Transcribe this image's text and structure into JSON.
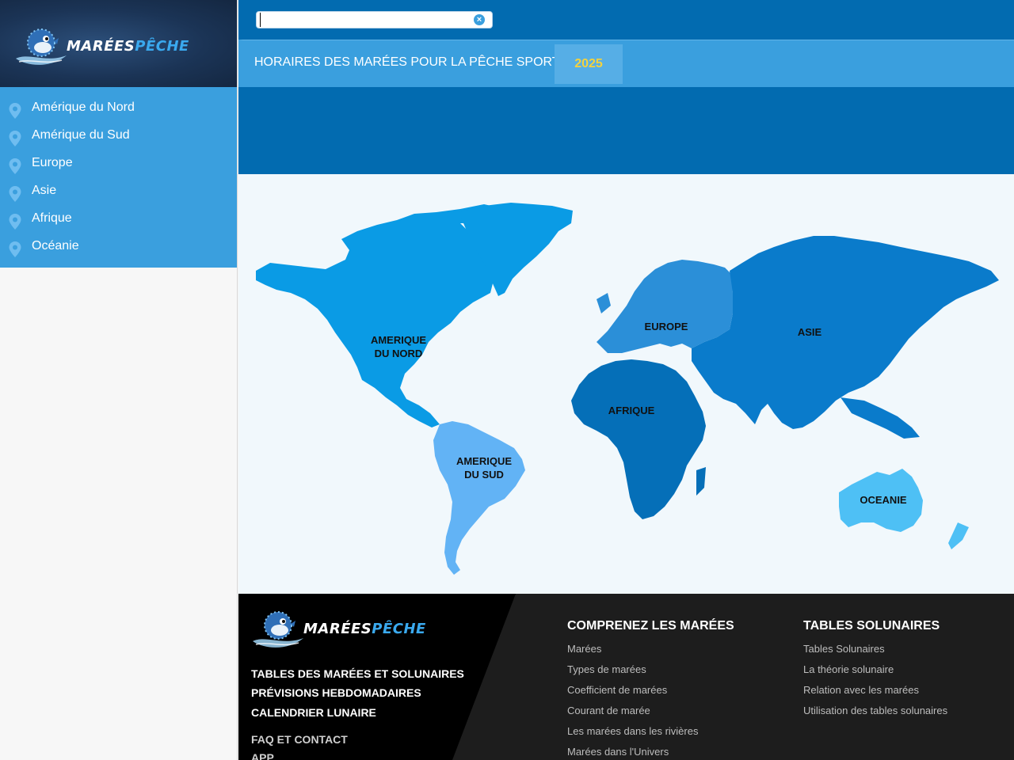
{
  "brand": {
    "logo_white": "MARÉES",
    "logo_blue": "PÊCHE"
  },
  "search": {
    "value": "",
    "placeholder": "",
    "clear_icon": "clear-circle-icon"
  },
  "header": {
    "title": "HORAIRES DES MARÉES POUR LA PÊCHE SPORTIVE",
    "year": "2025"
  },
  "sidebar": {
    "items": [
      {
        "label": "Amérique du Nord",
        "icon": "map-pin-icon"
      },
      {
        "label": "Amérique du Sud",
        "icon": "map-pin-icon"
      },
      {
        "label": "Europe",
        "icon": "map-pin-icon"
      },
      {
        "label": "Asie",
        "icon": "map-pin-icon"
      },
      {
        "label": "Afrique",
        "icon": "map-pin-icon"
      },
      {
        "label": "Océanie",
        "icon": "map-pin-icon"
      }
    ]
  },
  "map": {
    "regions": {
      "north_america": {
        "line1": "AMERIQUE",
        "line2": "DU NORD",
        "color": "#0a9be5"
      },
      "south_america": {
        "line1": "AMERIQUE",
        "line2": "DU SUD",
        "color": "#62b3f5"
      },
      "europe": {
        "label": "EUROPE",
        "color": "#2b8fd8"
      },
      "asia": {
        "label": "ASIE",
        "color": "#0a7bcb"
      },
      "africa": {
        "label": "AFRIQUE",
        "color": "#056fb8"
      },
      "oceania": {
        "label": "OCEANIE",
        "color": "#4ec0f5"
      }
    }
  },
  "footer": {
    "links_main": [
      "TABLES DES MARÉES ET SOLUNAIRES",
      "PRÉVISIONS HEBDOMADAIRES",
      "CALENDRIER LUNAIRE"
    ],
    "links_secondary": [
      "FAQ ET CONTACT",
      "APP"
    ],
    "col1": {
      "title": "COMPRENEZ LES MARÉES",
      "links": [
        "Marées",
        "Types de marées",
        "Coefficient de marées",
        "Courant de marée",
        "Les marées dans les rivières",
        "Marées dans l'Univers"
      ]
    },
    "col2": {
      "title": "TABLES SOLUNAIRES",
      "links": [
        "Tables Solunaires",
        "La théorie solunaire",
        "Relation avec les marées",
        "Utilisation des tables solunaires"
      ]
    }
  },
  "colors": {
    "accent": "#3a9fde",
    "dark_blue": "#026bb0",
    "year": "#f4d23d",
    "footer_bg": "#1d1d1d"
  }
}
